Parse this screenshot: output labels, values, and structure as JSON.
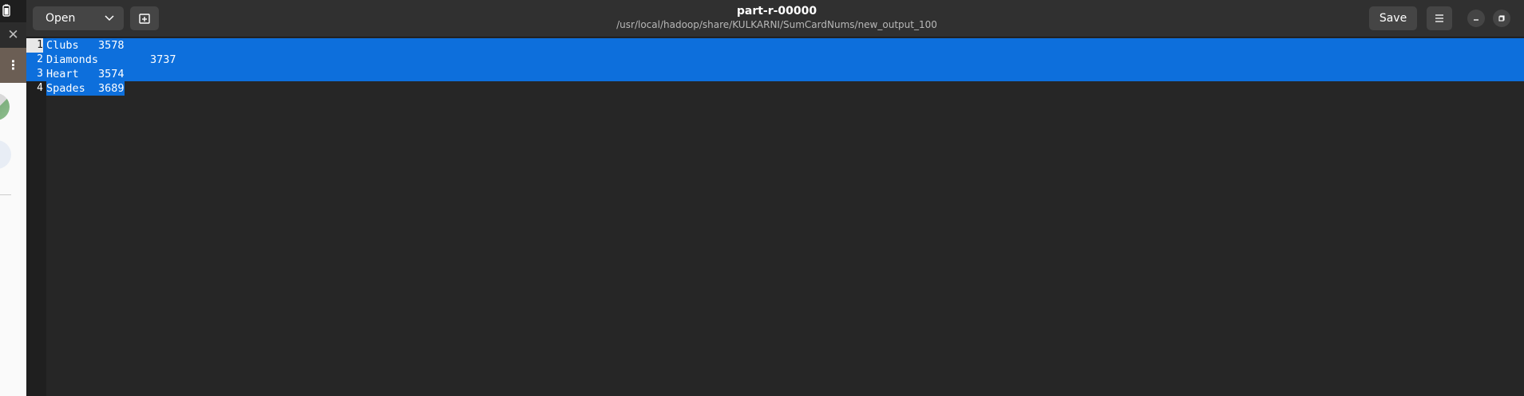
{
  "header": {
    "open_label": "Open",
    "save_label": "Save",
    "title": "part-r-00000",
    "subtitle": "/usr/local/hadoop/share/KULKARNI/SumCardNums/new_output_100"
  },
  "editor": {
    "lines": [
      {
        "number": "1",
        "text": "Clubs   3578"
      },
      {
        "number": "2",
        "text": "Diamonds        3737"
      },
      {
        "number": "3",
        "text": "Heart   3574"
      },
      {
        "number": "4",
        "text": "Spades  3689"
      }
    ]
  },
  "colors": {
    "selection": "#0d6fdc",
    "background": "#262626",
    "header": "#303030"
  },
  "icons": {
    "battery": "battery-icon",
    "close": "close-icon",
    "menu": "kebab-menu-icon",
    "chevron": "chevron-down-icon",
    "newtab": "new-tab-icon",
    "hamburger": "hamburger-icon",
    "minimize": "minimize-icon",
    "maximize": "maximize-icon"
  }
}
